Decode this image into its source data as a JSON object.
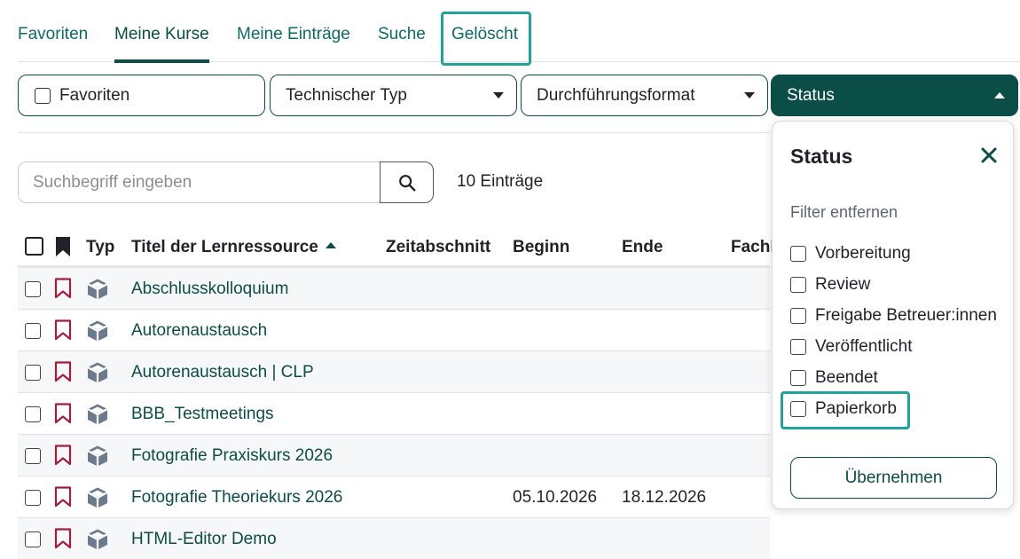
{
  "tabs": [
    {
      "label": "Favoriten"
    },
    {
      "label": "Meine Kurse"
    },
    {
      "label": "Meine Einträge"
    },
    {
      "label": "Suche"
    },
    {
      "label": "Gelöscht"
    }
  ],
  "filters": {
    "favorites": "Favoriten",
    "technical_type": "Technischer Typ",
    "format": "Durchführungsformat",
    "status": "Status"
  },
  "search": {
    "placeholder": "Suchbegriff eingeben",
    "count": "10 Einträge"
  },
  "table": {
    "columns": {
      "type": "Typ",
      "title": "Titel der Lernressource",
      "period": "Zeitabschnitt",
      "begin": "Beginn",
      "end": "Ende",
      "subject": "Fachl"
    },
    "rows": [
      {
        "title": "Abschlusskolloquium",
        "begin": "",
        "end": ""
      },
      {
        "title": "Autorenaustausch",
        "begin": "",
        "end": ""
      },
      {
        "title": "Autorenaustausch | CLP",
        "begin": "",
        "end": ""
      },
      {
        "title": "BBB_Testmeetings",
        "begin": "",
        "end": ""
      },
      {
        "title": "Fotografie Praxiskurs 2026",
        "begin": "",
        "end": ""
      },
      {
        "title": "Fotografie Theoriekurs 2026",
        "begin": "05.10.2026",
        "end": "18.12.2026"
      },
      {
        "title": "HTML-Editor Demo",
        "begin": "",
        "end": ""
      }
    ]
  },
  "status_panel": {
    "title": "Status",
    "reset": "Filter entfernen",
    "options": [
      {
        "label": "Vorbereitung"
      },
      {
        "label": "Review"
      },
      {
        "label": "Freigabe Betreuer:innen"
      },
      {
        "label": "Veröffentlicht"
      },
      {
        "label": "Beendet"
      },
      {
        "label": "Papierkorb"
      }
    ],
    "apply": "Übernehmen"
  },
  "colors": {
    "primary": "#0b4d47",
    "link": "#0d6b63",
    "highlight": "#22a39a",
    "bookmark": "#a31d3f",
    "cube": "#6b7a8c"
  },
  "icons": {
    "search": "search-icon",
    "close": "close-icon",
    "bookmark": "bookmark-icon",
    "course": "cube-icon"
  }
}
